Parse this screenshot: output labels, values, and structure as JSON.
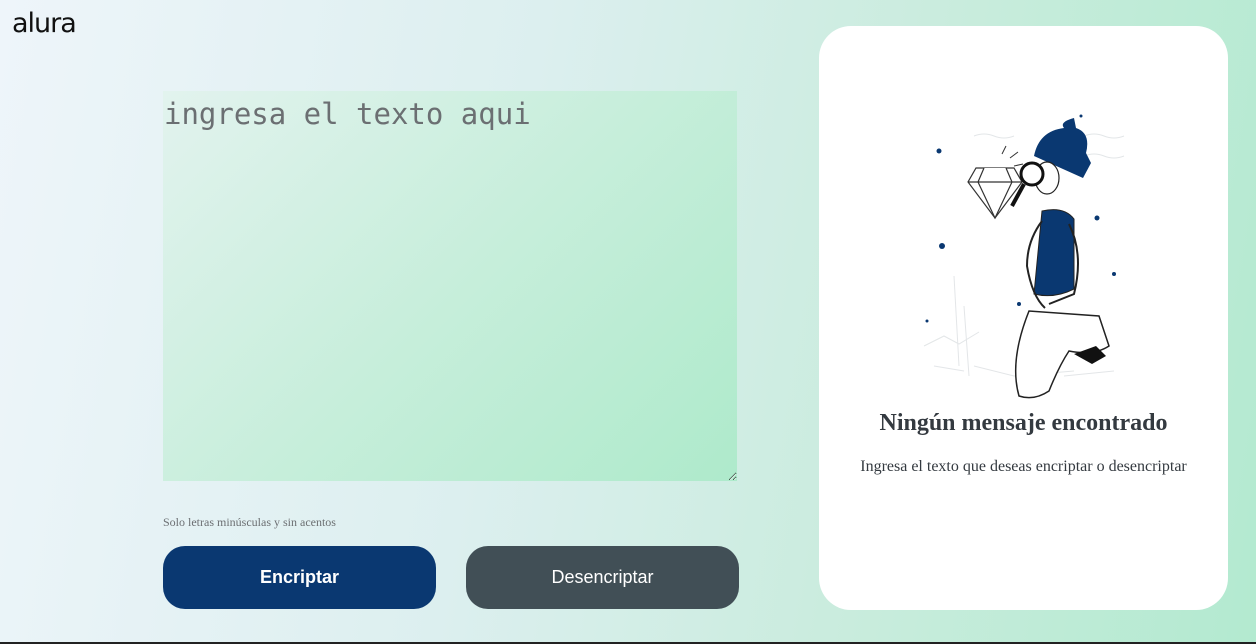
{
  "brand": {
    "logo_text": "alura"
  },
  "editor": {
    "placeholder": "ingresa el texto aqui",
    "hint": "Solo letras minúsculas y sin acentos"
  },
  "actions": {
    "encrypt_label": "Encriptar",
    "decrypt_label": "Desencriptar"
  },
  "output_panel": {
    "title": "Ningún mensaje encontrado",
    "message": "Ingresa el texto que deseas encriptar o desencriptar",
    "illustration": "person-magnifying-glass-diamond"
  },
  "colors": {
    "primary": "#0a3871",
    "secondary": "#414f56",
    "card": "#ffffff"
  }
}
